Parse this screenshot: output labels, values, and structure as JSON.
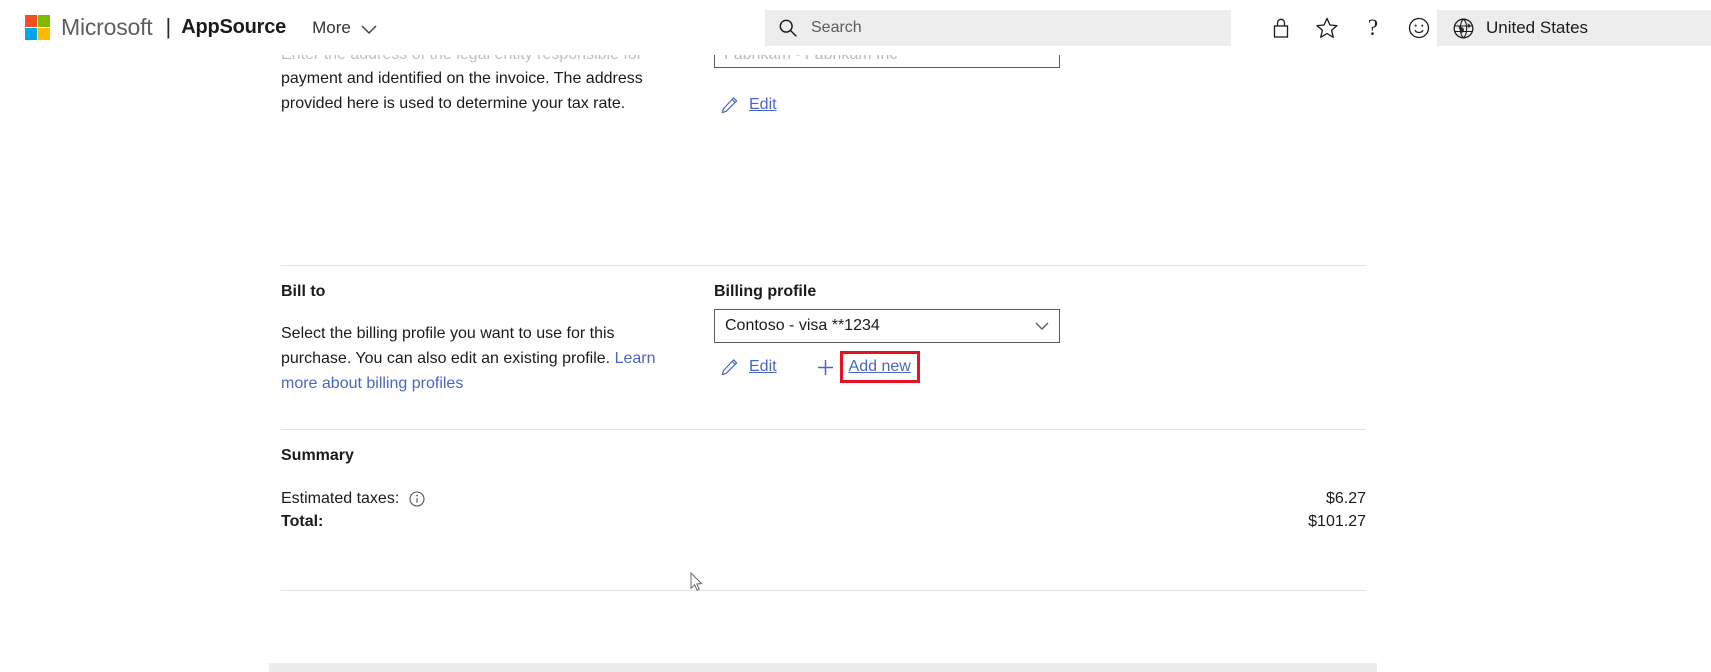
{
  "header": {
    "brand": "Microsoft",
    "separator": "|",
    "product": "AppSource",
    "more_label": "More",
    "search_placeholder": "Search",
    "search_value": "",
    "icons": [
      {
        "name": "lock-icon",
        "label": "Privacy"
      },
      {
        "name": "star-icon",
        "label": "Favorites"
      },
      {
        "name": "help-icon",
        "label": "?"
      },
      {
        "name": "feedback-smiley-icon",
        "label": "Feedback"
      }
    ],
    "help_glyph": "?",
    "region_label": "United States"
  },
  "sold_to": {
    "description_clipped": "Enter the address of the legal entity responsible for",
    "description_line2": "payment and identified on the invoice. The address",
    "description_line3": "provided here is used to determine your tax rate.",
    "combo_value_clipped": "Fabrikam - Fabrikam Inc",
    "edit_label": "Edit"
  },
  "bill_to": {
    "heading": "Bill to",
    "description_part1": "Select the billing profile you want to use for this purchase. You can also edit an existing profile. ",
    "link_text": "Learn more about billing profiles",
    "field_label": "Billing profile",
    "combo_value": "Contoso - visa **1234",
    "edit_label": "Edit",
    "add_new_label": "Add new"
  },
  "summary": {
    "heading": "Summary",
    "rows": [
      {
        "label": "Estimated taxes:",
        "value": "$6.27",
        "bold": false,
        "has_info": true
      },
      {
        "label": "Total:",
        "value": "$101.27",
        "bold": true,
        "has_info": false
      }
    ]
  },
  "colors": {
    "link": "#4a66c4",
    "highlight": "#e81123",
    "ms_red": "#f25022",
    "ms_green": "#7fba00",
    "ms_blue": "#00a4ef",
    "ms_yellow": "#ffb900",
    "header_chip_bg": "#ededed"
  }
}
